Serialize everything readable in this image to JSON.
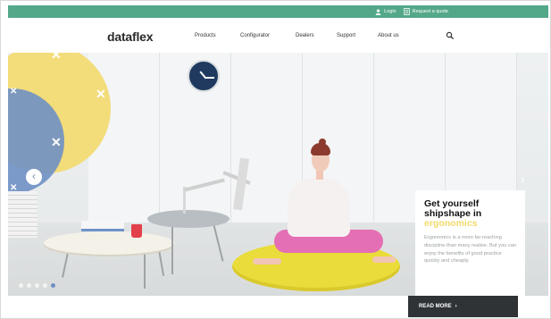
{
  "topbar": {
    "login_label": "Login",
    "quote_label": "Request a quote",
    "icons": [
      "user-icon",
      "document-icon"
    ]
  },
  "header": {
    "logo_main": "dataflex",
    "nav": [
      "Products",
      "Configurator",
      "Dealers",
      "Support",
      "About us"
    ]
  },
  "hero": {
    "card": {
      "title_line1": "Get yourself",
      "title_line2": "shipshape in",
      "title_highlight": "ergonomics",
      "body": "Ergonomics is a more far-reaching discipline than many realise. But you can enjoy the benefits of good practice quickly and cheaply.",
      "cta": "READ MORE",
      "cta_arrow": "›"
    },
    "slides": 5,
    "active_slide": 5
  },
  "colors": {
    "topbar": "#54a88a",
    "brand_dark": "#2a2a2a",
    "accent_yellow": "#f2d96a",
    "button_dark": "#2f3336"
  }
}
